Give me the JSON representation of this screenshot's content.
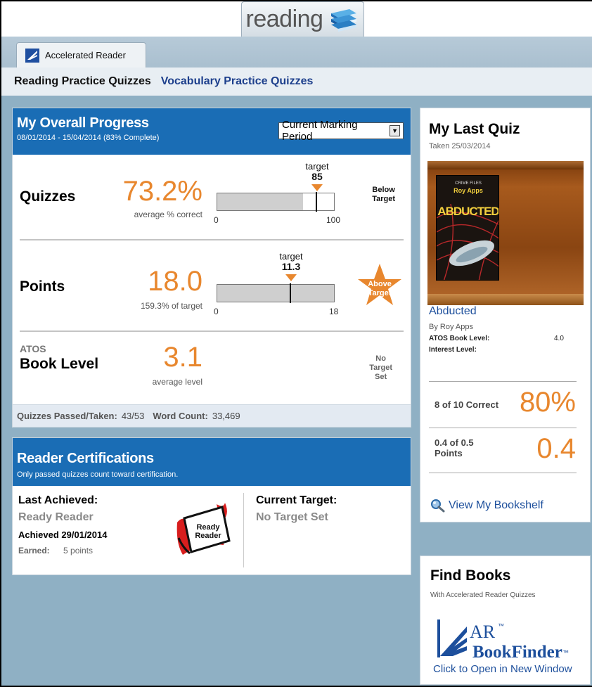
{
  "top": {
    "section_tab": "reading"
  },
  "app_tab": {
    "label": "Accelerated Reader"
  },
  "subnav": {
    "active": "Reading Practice Quizzes",
    "link": "Vocabulary Practice Quizzes"
  },
  "progress": {
    "title": "My Overall Progress",
    "period_range": "08/01/2014 - 15/04/2014 (83% Complete)",
    "period_select": "Current Marking Period",
    "quizzes": {
      "label": "Quizzes",
      "value": "73.2%",
      "caption": "average % correct",
      "target_word": "target",
      "target_value": "85",
      "axis_min": "0",
      "axis_max": "100",
      "status": [
        "Below",
        "Target"
      ],
      "fill_fraction": 0.732,
      "target_fraction": 0.85
    },
    "points": {
      "label": "Points",
      "value": "18.0",
      "caption": "159.3% of target",
      "target_word": "target",
      "target_value": "11.3",
      "axis_min": "0",
      "axis_max": "18",
      "status": [
        "Above",
        "Target"
      ],
      "fill_fraction": 1.0,
      "target_fraction": 0.628
    },
    "book_level": {
      "label_small": "ATOS",
      "label": "Book Level",
      "value": "3.1",
      "caption": "average level",
      "status": [
        "No",
        "Target",
        "Set"
      ]
    },
    "footer": {
      "passed_label": "Quizzes Passed/Taken:",
      "passed_value": "43/53",
      "word_label": "Word Count:",
      "word_value": "33,469"
    }
  },
  "certifications": {
    "title": "Reader Certifications",
    "subtitle": "Only passed quizzes count toward certification.",
    "last_achieved_label": "Last Achieved:",
    "last_level": "Ready Reader",
    "achieved_date": "Achieved 29/01/2014",
    "earned_label": "Earned:",
    "earned_value": "5 points",
    "badge_text_1": "Ready",
    "badge_text_2": "Reader",
    "current_target_label": "Current Target:",
    "current_target_value": "No Target Set"
  },
  "last_quiz": {
    "title": "My Last Quiz",
    "taken": "Taken 25/03/2014",
    "cover_series": "CRIME FILES",
    "cover_author": "Roy Apps",
    "cover_title": "ABDUCTED",
    "book_title": "Abducted",
    "author": "By Roy Apps",
    "atos_label": "ATOS Book Level:",
    "atos_value": "4.0",
    "interest_label": "Interest Level:",
    "correct_label": "8 of 10 Correct",
    "correct_value": "80%",
    "points_label_1": "0.4 of 0.5",
    "points_label_2": "Points",
    "points_value": "0.4",
    "bookshelf_link": "View My Bookshelf"
  },
  "find_books": {
    "title": "Find Books",
    "subtitle": "With Accelerated Reader Quizzes",
    "logo_ar": "AR",
    "logo_tm": "™",
    "logo_bookfinder": "BookFinder",
    "link": "Click to Open in New Window"
  },
  "colors": {
    "accent_orange": "#e8872e",
    "header_blue": "#1a6db5",
    "link_blue": "#1d4f9c",
    "page_bg": "#8fb0c4"
  },
  "icons": [
    "books-icon",
    "accelerated-reader-logo-icon",
    "dropdown-arrow-icon",
    "target-marker-icon",
    "star-icon",
    "certificate-badge-icon",
    "magnifier-icon",
    "bookfinder-logo-icon"
  ]
}
